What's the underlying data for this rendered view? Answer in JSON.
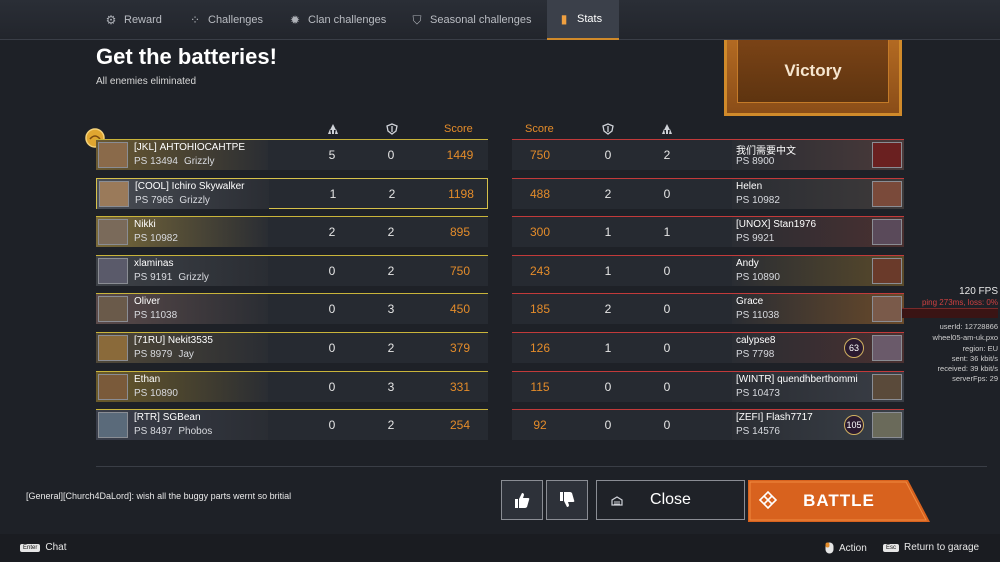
{
  "tabs": [
    {
      "label": "Reward",
      "icon": "gear-icon"
    },
    {
      "label": "Challenges",
      "icon": "challenges-icon"
    },
    {
      "label": "Clan challenges",
      "icon": "clan-icon"
    },
    {
      "label": "Seasonal challenges",
      "icon": "seasonal-icon"
    },
    {
      "label": "Stats",
      "icon": "stats-icon"
    }
  ],
  "header": {
    "title": "Get the batteries!",
    "subtitle": "All enemies eliminated",
    "result": "Victory"
  },
  "columns": {
    "score": "Score"
  },
  "left_team": [
    {
      "name": "[JKL] АНТОНІОСАНТРЕ",
      "ps": "PS 13494",
      "clan": "Grizzly",
      "kills": "5",
      "deaths": "0",
      "score": "1449"
    },
    {
      "name": "[COOL] Ichiro Skywalker",
      "ps": "PS 7965",
      "clan": "Grizzly",
      "kills": "1",
      "deaths": "2",
      "score": "1198"
    },
    {
      "name": "Nikki",
      "ps": "PS 10982",
      "clan": "",
      "kills": "2",
      "deaths": "2",
      "score": "895"
    },
    {
      "name": "xlaminas",
      "ps": "PS 9191",
      "clan": "Grizzly",
      "kills": "0",
      "deaths": "2",
      "score": "750"
    },
    {
      "name": "Oliver",
      "ps": "PS 11038",
      "clan": "",
      "kills": "0",
      "deaths": "3",
      "score": "450"
    },
    {
      "name": "[71RU] Nekit3535",
      "ps": "PS 8979",
      "clan": "Jay",
      "kills": "0",
      "deaths": "2",
      "score": "379"
    },
    {
      "name": "Ethan",
      "ps": "PS 10890",
      "clan": "",
      "kills": "0",
      "deaths": "3",
      "score": "331"
    },
    {
      "name": "[RTR] SGBean",
      "ps": "PS 8497",
      "clan": "Phobos",
      "kills": "0",
      "deaths": "2",
      "score": "254"
    }
  ],
  "right_team": [
    {
      "name": "我们需要中文",
      "ps": "PS 8900",
      "score": "750",
      "deaths": "0",
      "kills": "2"
    },
    {
      "name": "Helen",
      "ps": "PS 10982",
      "score": "488",
      "deaths": "2",
      "kills": "0"
    },
    {
      "name": "[UNOX] Stan1976",
      "ps": "PS 9921",
      "score": "300",
      "deaths": "1",
      "kills": "1"
    },
    {
      "name": "Andy",
      "ps": "PS 10890",
      "score": "243",
      "deaths": "1",
      "kills": "0"
    },
    {
      "name": "Grace",
      "ps": "PS 11038",
      "score": "185",
      "deaths": "2",
      "kills": "0"
    },
    {
      "name": "calypse8",
      "ps": "PS 7798",
      "score": "126",
      "deaths": "1",
      "kills": "0",
      "badge": "63"
    },
    {
      "name": "[WINTR] quendhberthommi",
      "ps": "PS 10473",
      "score": "115",
      "deaths": "0",
      "kills": "0"
    },
    {
      "name": "[ZEFI] Flash7717",
      "ps": "PS 14576",
      "score": "92",
      "deaths": "0",
      "kills": "0",
      "badge": "105"
    }
  ],
  "chat": {
    "message": "[General][Church4DaLord]: wish all the buggy parts wernt so britial"
  },
  "buttons": {
    "close": "Close",
    "battle": "BATTLE"
  },
  "bottom": {
    "enter_key": "Enter",
    "chat": "Chat",
    "action": "Action",
    "esc_key": "Esc",
    "return": "Return to garage"
  },
  "perf": {
    "fps": "120 FPS",
    "ping": "ping 273ms, loss: 0%",
    "user": "userId: 12728866",
    "server": "wheel05-am-uk.pxo",
    "region": "region: EU",
    "sent": "sent: 36 kbit/s",
    "received": "received: 39 kbit/s",
    "serverfps": "serverFps: 29"
  },
  "colors": {
    "accent": "#e48c2a",
    "ally_line": "#c9b43a",
    "enemy_line": "#c23a3a",
    "battle_btn": "#d8621e"
  }
}
